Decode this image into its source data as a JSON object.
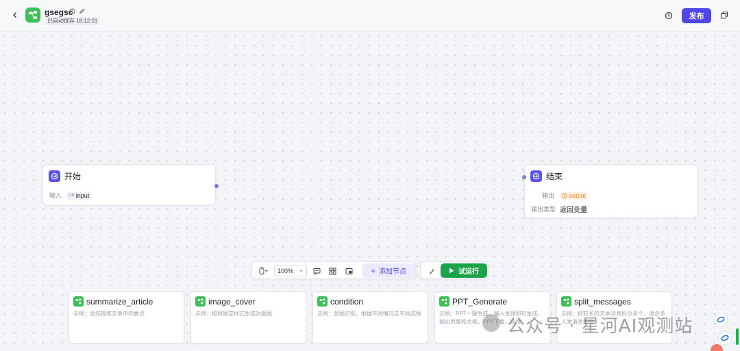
{
  "header": {
    "title": "gsegsc",
    "autosave": "已自动保存 18:12:01",
    "publish_label": "发布"
  },
  "nodes": {
    "start": {
      "title": "开始",
      "input_label": "输入",
      "input_type": "str",
      "input_name": "input"
    },
    "end": {
      "title": "结束",
      "output_label": "输出",
      "output_name": "output",
      "output_type_label": "输出类型",
      "output_type_value": "返回变量"
    }
  },
  "toolbar": {
    "zoom": "100%",
    "add_node_label": "添加节点",
    "run_label": "试运行"
  },
  "cards": [
    {
      "title": "summarize_article",
      "desc": "示例：总结提炼文章中的要点"
    },
    {
      "title": "image_cover",
      "desc": "示例：按照固定样式生成封面图"
    },
    {
      "title": "condition",
      "desc": "示例：意图识别，根据不同情况走不同流程"
    },
    {
      "title": "PPT_Generate",
      "desc": "示例：PPT一键生成，输入主题即可生成，输出思路和大纲，PPT下载，流程"
    },
    {
      "title": "split_messages",
      "desc": "示例：把较长的文本消息拆分多个，适合多人发消息场景"
    }
  ],
  "watermark": "公众号 · 星河AI观测站",
  "colors": {
    "accent": "#4f46e5",
    "run": "#1ba34a",
    "app_icon": "#3fbf5a",
    "output_tag": "#f08c2b"
  }
}
